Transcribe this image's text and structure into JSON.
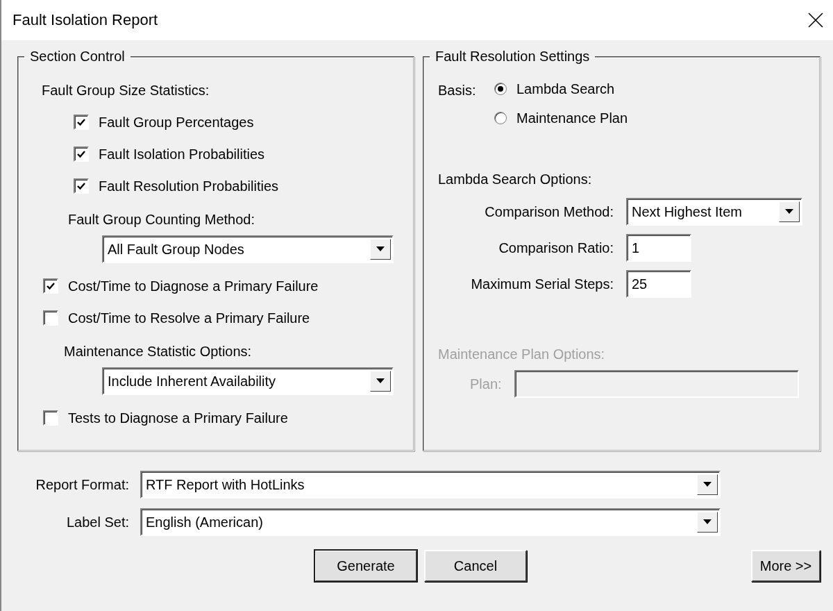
{
  "window": {
    "title": "Fault Isolation Report"
  },
  "section_control": {
    "title": "Section Control",
    "items": [
      {
        "kind": "group",
        "label": "Fault Group Size Statistics:",
        "children": [
          {
            "kind": "checkbox",
            "label": "Fault Group Percentages",
            "checked": true
          },
          {
            "kind": "checkbox",
            "label": "Fault Isolation Probabilities",
            "checked": true
          },
          {
            "kind": "checkbox",
            "label": "Fault Resolution Probabilities",
            "checked": true
          },
          {
            "kind": "dropdown",
            "label": "Fault Group Counting Method:",
            "value": "All Fault Group Nodes"
          }
        ]
      },
      {
        "kind": "checkbox",
        "label": "Cost/Time to Diagnose a Primary Failure",
        "checked": true
      },
      {
        "kind": "checkbox",
        "label": "Cost/Time to Resolve a Primary Failure",
        "checked": false
      },
      {
        "kind": "dropdown",
        "label": "Maintenance Statistic Options:",
        "value": "Include Inherent Availability"
      },
      {
        "kind": "checkbox",
        "label": "Tests to Diagnose a Primary Failure",
        "checked": false
      }
    ]
  },
  "fault_resolution": {
    "title": "Fault Resolution Settings",
    "basis": {
      "label": "Basis:",
      "options": [
        {
          "label": "Lambda Search",
          "selected": true
        },
        {
          "label": "Maintenance Plan",
          "selected": false
        }
      ]
    },
    "lambda_options": {
      "title": "Lambda Search Options:",
      "fields": [
        {
          "kind": "dropdown",
          "label": "Comparison Method:",
          "value": "Next Highest Item"
        },
        {
          "kind": "text",
          "label": "Comparison Ratio:",
          "value": "1"
        },
        {
          "kind": "text",
          "label": "Maximum Serial Steps:",
          "value": "25"
        }
      ]
    },
    "maintenance_plan": {
      "title": "Maintenance Plan Options:",
      "disabled": true,
      "plan_label": "Plan:"
    }
  },
  "report_fields": [
    {
      "label": "Report Format:",
      "value": "RTF Report with HotLinks"
    },
    {
      "label": "Label Set:",
      "value": "English (American)"
    }
  ],
  "buttons": [
    {
      "label": "Generate",
      "default": true
    },
    {
      "label": "Cancel",
      "default": false
    }
  ],
  "more_button": {
    "label": "More >>"
  }
}
